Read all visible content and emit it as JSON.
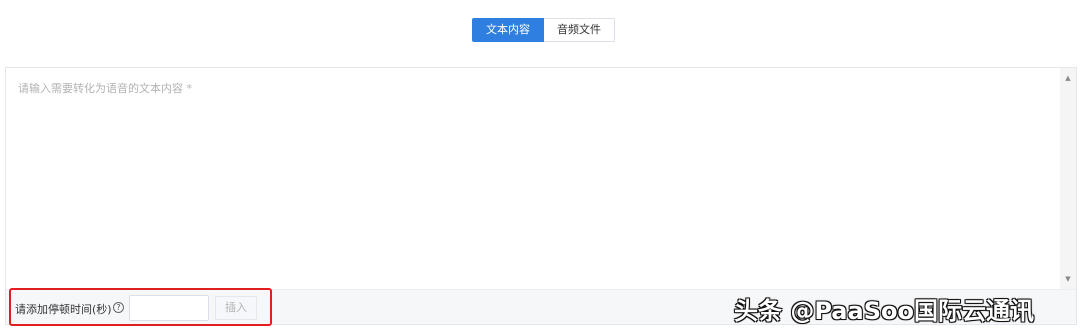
{
  "tabs": [
    {
      "label": "文本内容",
      "active": true
    },
    {
      "label": "音频文件",
      "active": false
    }
  ],
  "editor": {
    "placeholder": "请输入需要转化为语音的文本内容 *",
    "value": ""
  },
  "scrollbar": {
    "up_icon": "▲",
    "down_icon": "▼"
  },
  "pause": {
    "label": "请添加停顿时间(秒)",
    "help_icon": "?",
    "input_value": "",
    "insert_label": "插入"
  },
  "colors": {
    "accent": "#2f7fe0",
    "highlight": "#e02020"
  },
  "watermark": {
    "text": "头条 @PaaSoo国际云通讯"
  }
}
